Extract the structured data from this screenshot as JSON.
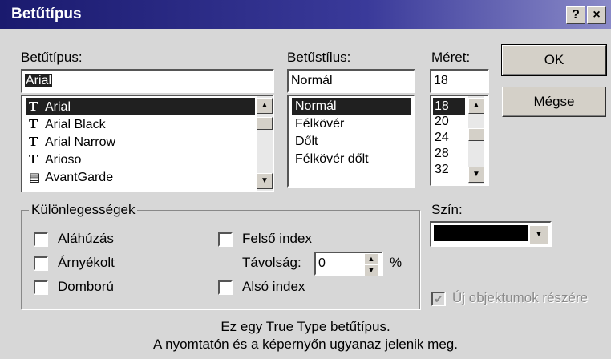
{
  "window": {
    "title": "Betűtípus",
    "help": "?",
    "close": "×"
  },
  "font": {
    "label": "Betűtípus:",
    "value": "Arial",
    "items": [
      "Arial",
      "Arial Black",
      "Arial Narrow",
      "Arioso",
      "AvantGarde"
    ]
  },
  "style": {
    "label": "Betűstílus:",
    "value": "Normál",
    "items": [
      "Normál",
      "Félkövér",
      "Dőlt",
      "Félkövér dőlt"
    ]
  },
  "size": {
    "label": "Méret:",
    "value": "18",
    "items": [
      "18",
      "20",
      "24",
      "28",
      "32"
    ]
  },
  "buttons": {
    "ok": "OK",
    "cancel": "Mégse"
  },
  "effects": {
    "legend": "Különlegességek",
    "underline": "Aláhúzás",
    "shadow": "Árnyékolt",
    "emboss": "Domború",
    "superscript": "Felső index",
    "offset_label": "Távolság:",
    "offset_value": "0",
    "offset_unit": "%",
    "subscript": "Alsó index"
  },
  "color": {
    "label": "Szín:",
    "value_color": "#000000"
  },
  "default_check": {
    "label": "Új objektumok részére",
    "checked": true
  },
  "info": {
    "line1": "Ez egy True Type betűtípus.",
    "line2": "A nyomtatón és a képernyőn ugyanaz jelenik meg."
  }
}
